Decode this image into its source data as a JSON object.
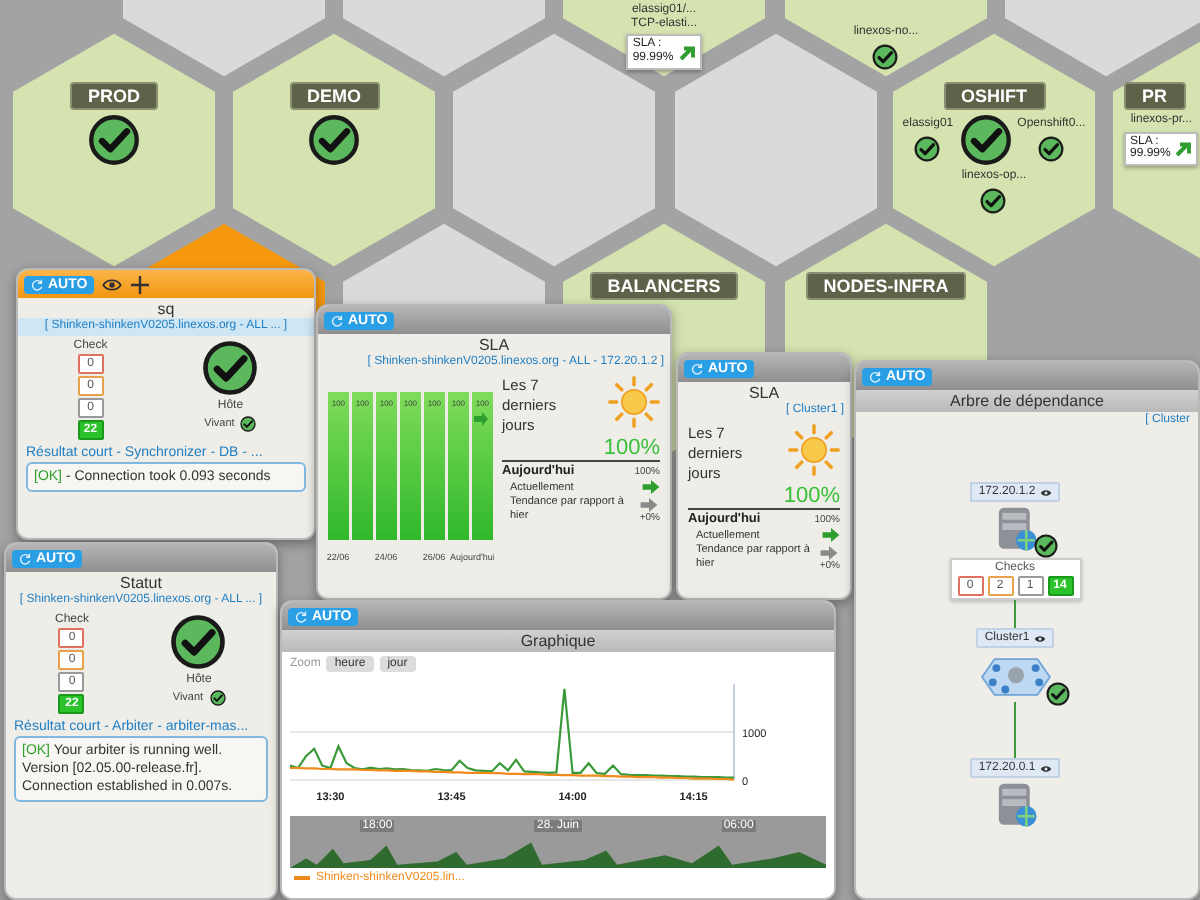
{
  "hex_map": {
    "tiles": [
      {
        "kind": "empty",
        "selected": false
      },
      {
        "kind": "empty",
        "selected": false
      },
      {
        "kind": "hosts",
        "selected": false,
        "hosts": [
          {
            "name": "elassig01/...",
            "detail": "TCP-elasti...",
            "ok": false
          }
        ],
        "sla": {
          "label": "SLA :",
          "value": "99.99%",
          "color": "#2e9e2e"
        }
      },
      {
        "kind": "hosts",
        "selected": false,
        "hosts": [
          {
            "name": "linexos-no...",
            "ok": true
          }
        ]
      },
      {
        "kind": "empty",
        "selected": false
      },
      {
        "kind": "group",
        "selected": false,
        "label": "PROD",
        "ok": true
      },
      {
        "kind": "group",
        "selected": false,
        "label": "DEMO",
        "ok": true
      },
      {
        "kind": "empty",
        "selected": false
      },
      {
        "kind": "empty",
        "selected": false
      },
      {
        "kind": "group",
        "selected": false,
        "label": "OSHIFT",
        "ok": true,
        "hosts": [
          {
            "name": "elassig01",
            "ok": true
          },
          {
            "name": "Openshift0...",
            "ok": true
          },
          {
            "name": "linexos-op...",
            "ok": true
          }
        ]
      },
      {
        "kind": "group",
        "selected": false,
        "label": "PR",
        "ok": false,
        "hosts": [
          {
            "name": "linexos-pr...",
            "ok": false
          }
        ],
        "sla": {
          "label": "SLA :",
          "value": "99.99%",
          "color": "#2e9e2e"
        }
      },
      {
        "kind": "empty",
        "selected": true
      },
      {
        "kind": "empty",
        "selected": false
      },
      {
        "kind": "group",
        "selected": false,
        "label": "BALANCERS",
        "ok": false
      },
      {
        "kind": "group",
        "selected": false,
        "label": "NODES-INFRA",
        "ok": false
      }
    ]
  },
  "panels": [
    {
      "kind": "status",
      "selected": true,
      "auto": "AUTO",
      "title": "sq",
      "subtitle": "[ Shinken-shinkenV0205.linexos.org - ALL ... ]",
      "check_label": "Check",
      "counters": [
        {
          "kind": "critical",
          "value": "0"
        },
        {
          "kind": "warning",
          "value": "0"
        },
        {
          "kind": "unknown",
          "value": "0"
        },
        {
          "kind": "ok",
          "value": "22"
        }
      ],
      "ok": true,
      "host_label": "Hôte",
      "alive_label": "Vivant",
      "alive": true,
      "result_title": "Résultat court - Synchronizer - DB - ...",
      "result": {
        "status": "[OK]",
        "text": "- Connection took 0.093 seconds"
      }
    },
    {
      "kind": "status",
      "selected": false,
      "auto": "AUTO",
      "title": "Statut",
      "subtitle": "[ Shinken-shinkenV0205.linexos.org - ALL ... ]",
      "check_label": "Check",
      "counters": [
        {
          "kind": "critical",
          "value": "0"
        },
        {
          "kind": "warning",
          "value": "0"
        },
        {
          "kind": "unknown",
          "value": "0"
        },
        {
          "kind": "ok",
          "value": "22"
        }
      ],
      "ok": true,
      "host_label": "Hôte",
      "alive_label": "Vivant",
      "alive": true,
      "result_title": "Résultat court - Arbiter - arbiter-mas...",
      "result": {
        "status": "[OK]",
        "text": "Your arbiter is running well. Version [02.05.00-release.fr]. Connection established in 0.007s."
      }
    },
    {
      "kind": "sla",
      "selected": false,
      "auto": "AUTO",
      "title": "SLA",
      "subtitle": "[ Shinken-shinkenV0205.linexos.org - ALL - 172.20.1.2 ]",
      "chart_data": {
        "type": "bar",
        "categories": [
          "22/06",
          null,
          "24/06",
          null,
          "26/06",
          null,
          "Aujourd'hui"
        ],
        "values": [
          100,
          100,
          100,
          100,
          100,
          100,
          100
        ],
        "data_labels": true
      },
      "period_label": "Les 7 derniers jours",
      "period_value": "100%",
      "today_label": "Aujourd'hui",
      "today_value": "100%",
      "current": {
        "label": "Actuellement",
        "color": "#2e9e2e"
      },
      "tendency": {
        "label": "Tendance par rapport à hier",
        "color": "#8a8a8a",
        "value": "+0%"
      }
    },
    {
      "kind": "sla",
      "selected": false,
      "auto": "AUTO",
      "title": "SLA",
      "subtitle": "[ Cluster1 ]",
      "period_label": "Les 7 derniers jours",
      "period_value": "100%",
      "today_label": "Aujourd'hui",
      "today_value": "100%",
      "current": {
        "label": "Actuellement",
        "color": "#2e9e2e"
      },
      "tendency": {
        "label": "Tendance par rapport à hier",
        "color": "#8a8a8a",
        "value": "+0%"
      }
    },
    {
      "kind": "graph",
      "selected": false,
      "auto": "AUTO",
      "title": "Graphique",
      "zoom_label": "Zoom",
      "zoom_buttons": [
        {
          "label": "heure",
          "selected": false
        },
        {
          "label": "jour",
          "selected": false
        }
      ],
      "chart_data": {
        "type": "line",
        "categories": [
          null,
          null,
          null,
          null,
          null,
          "13:30",
          null,
          null,
          null,
          null,
          null,
          null,
          null,
          null,
          null,
          null,
          null,
          null,
          null,
          null,
          "13:45",
          null,
          null,
          null,
          null,
          null,
          null,
          null,
          null,
          null,
          null,
          null,
          null,
          null,
          null,
          "14:00",
          null,
          null,
          null,
          null,
          null,
          null,
          null,
          null,
          null,
          null,
          null,
          null,
          null,
          null,
          "14:15",
          null,
          null,
          null,
          null,
          null
        ],
        "ylim": [
          0,
          2000
        ],
        "yticks": [
          0,
          1000
        ],
        "series": [
          {
            "color": "#3a9a3a",
            "values": [
              300,
              250,
              500,
              650,
              300,
              250,
              700,
              350,
              250,
              220,
              260,
              230,
              240,
              220,
              230,
              210,
              200,
              190,
              230,
              210,
              200,
              400,
              250,
              200,
              190,
              180,
              350,
              200,
              420,
              180,
              170,
              160,
              150,
              160,
              1900,
              150,
              150,
              350,
              140,
              130,
              300,
              120,
              110,
              100,
              100,
              90,
              90,
              80,
              80,
              70,
              70,
              60,
              60,
              60,
              50,
              50
            ]
          },
          {
            "name": "Shinken-shinkenV0205.lin...",
            "color": "#f08a1c",
            "values": [
              250,
              250,
              240,
              240,
              230,
              230,
              220,
              220,
              220,
              210,
              210,
              200,
              200,
              190,
              190,
              190,
              180,
              180,
              170,
              170,
              160,
              160,
              150,
              150,
              150,
              140,
              140,
              130,
              130,
              120,
              120,
              120,
              110,
              110,
              100,
              100,
              90,
              90,
              90,
              80,
              80,
              70,
              70,
              60,
              60,
              60,
              50,
              50,
              40,
              40,
              30,
              30,
              30,
              20,
              20,
              10
            ]
          }
        ]
      },
      "navigator_labels": [
        "18:00",
        "28. Juin",
        "06:00"
      ]
    },
    {
      "kind": "tree",
      "selected": false,
      "auto": "AUTO",
      "title": "Arbre de dépendance",
      "subtitle": "[ Cluster",
      "nodes": [
        {
          "kind": "server",
          "label": "172.20.1.2",
          "ok": true,
          "checks": {
            "label": "Checks",
            "counters": [
              {
                "kind": "critical",
                "value": "0"
              },
              {
                "kind": "warning",
                "value": "2"
              },
              {
                "kind": "unknown",
                "value": "1"
              },
              {
                "kind": "ok",
                "value": "14"
              }
            ]
          }
        },
        {
          "kind": "cluster",
          "label": "Cluster1",
          "ok": true
        },
        {
          "kind": "server",
          "label": "172.20.0.1",
          "ok": false
        }
      ]
    }
  ]
}
